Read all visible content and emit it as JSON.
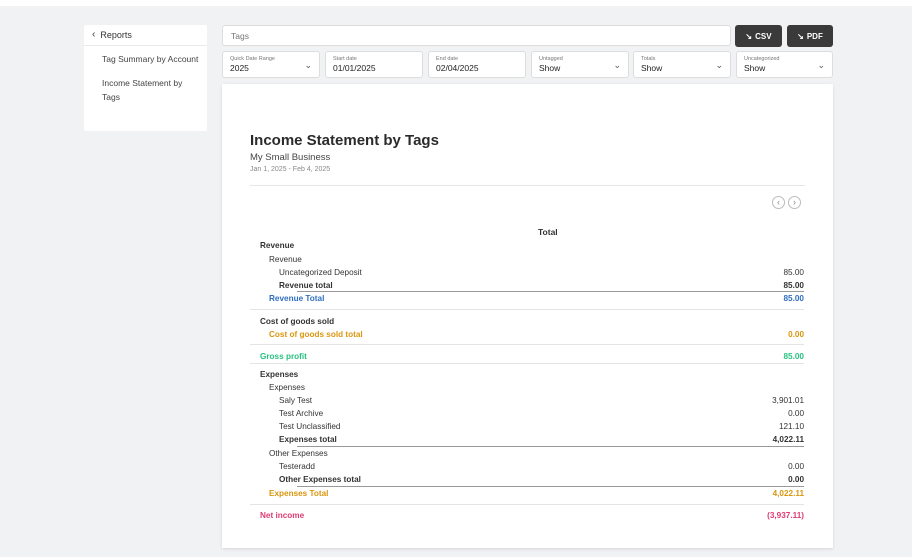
{
  "sidebar": {
    "back_label": "Reports",
    "items": [
      {
        "label": "Tag Summary by Account"
      },
      {
        "label": "Income Statement by Tags"
      }
    ]
  },
  "search": {
    "placeholder": "Tags"
  },
  "buttons": {
    "csv": "CSV",
    "pdf": "PDF"
  },
  "filters": [
    {
      "label": "Quick Date Range",
      "value": "2025",
      "dropdown": true
    },
    {
      "label": "Start date",
      "value": "01/01/2025",
      "dropdown": false
    },
    {
      "label": "End date",
      "value": "02/04/2025",
      "dropdown": false
    },
    {
      "label": "Untagged",
      "value": "Show",
      "dropdown": true
    },
    {
      "label": "Totals",
      "value": "Show",
      "dropdown": true
    },
    {
      "label": "Uncategorized",
      "value": "Show",
      "dropdown": true
    }
  ],
  "report": {
    "title": "Income Statement by Tags",
    "company": "My Small Business",
    "date_range": "Jan 1, 2025 - Feb 4, 2025",
    "column_header": "Total",
    "rows": [
      {
        "label": "Revenue",
        "value": "",
        "indent": 0,
        "style": "bold"
      },
      {
        "label": "Revenue",
        "value": "",
        "indent": 1,
        "style": "normal"
      },
      {
        "label": "Uncategorized Deposit",
        "value": "85.00",
        "indent": 2,
        "style": "normal"
      },
      {
        "label": "Revenue total",
        "value": "85.00",
        "indent": 2,
        "style": "bold"
      },
      {
        "label": "Revenue Total",
        "value": "85.00",
        "indent": 1,
        "style": "blue"
      },
      {
        "label": "Cost of goods sold",
        "value": "",
        "indent": 0,
        "style": "bold"
      },
      {
        "label": "Cost of goods sold total",
        "value": "0.00",
        "indent": 1,
        "style": "orange"
      },
      {
        "label": "Gross profit",
        "value": "85.00",
        "indent": 0,
        "style": "green"
      },
      {
        "label": "Expenses",
        "value": "",
        "indent": 0,
        "style": "bold"
      },
      {
        "label": "Expenses",
        "value": "",
        "indent": 1,
        "style": "normal"
      },
      {
        "label": "Saly Test",
        "value": "3,901.01",
        "indent": 2,
        "style": "normal"
      },
      {
        "label": "Test Archive",
        "value": "0.00",
        "indent": 2,
        "style": "normal"
      },
      {
        "label": "Test Unclassified",
        "value": "121.10",
        "indent": 2,
        "style": "normal"
      },
      {
        "label": "Expenses total",
        "value": "4,022.11",
        "indent": 2,
        "style": "bold"
      },
      {
        "label": "Other Expenses",
        "value": "",
        "indent": 1,
        "style": "normal"
      },
      {
        "label": "Testeradd",
        "value": "0.00",
        "indent": 2,
        "style": "normal"
      },
      {
        "label": "Other Expenses total",
        "value": "0.00",
        "indent": 2,
        "style": "bold"
      },
      {
        "label": "Expenses Total",
        "value": "4,022.11",
        "indent": 1,
        "style": "orange"
      },
      {
        "label": "Net income",
        "value": "(3,937.11)",
        "indent": 0,
        "style": "pink"
      }
    ]
  },
  "colors": {
    "accent_blue": "#2f6fbf",
    "accent_orange": "#d9960e",
    "accent_green": "#27c27f",
    "accent_pink": "#e03a74",
    "button_dark": "#3a3a3a"
  }
}
